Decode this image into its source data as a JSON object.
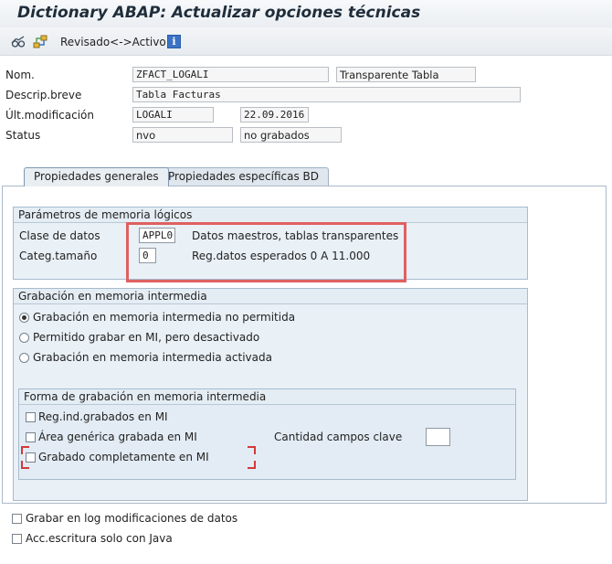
{
  "title": "Dictionary ABAP: Actualizar opciones técnicas",
  "toolbar": {
    "toggle_label": "Revisado<->Activo",
    "icons": [
      "glasses-icon",
      "hierarchy-icon",
      "info-icon"
    ]
  },
  "header": {
    "name_label": "Nom.",
    "name_value": "ZFACT_LOGALI",
    "table_type": "Transparente Tabla",
    "desc_label": "Descrip.breve",
    "desc_value": "Tabla Facturas",
    "lastmod_label": "Últ.modificación",
    "lastmod_user": "LOGALI",
    "lastmod_date": "22.09.2016",
    "status_label": "Status",
    "status_value": "nvo",
    "status_text": "no grabados"
  },
  "tabs": [
    {
      "label": "Propiedades generales",
      "active": true
    },
    {
      "label": "Propiedades específicas BD",
      "active": false
    }
  ],
  "memory_params": {
    "title": "Parámetros de memoria lógicos",
    "data_class_label": "Clase de datos",
    "data_class_value": "APPL0",
    "data_class_desc": "Datos maestros, tablas transparentes",
    "size_label": "Categ.tamaño",
    "size_value": "0",
    "size_desc": "Reg.datos esperados 0 A 11.000"
  },
  "buffering": {
    "title": "Grabación en memoria intermedia",
    "options": [
      {
        "label": "Grabación en memoria intermedia no permitida",
        "selected": true
      },
      {
        "label": "Permitido grabar en MI, pero desactivado",
        "selected": false
      },
      {
        "label": "Grabación en memoria intermedia activada",
        "selected": false
      }
    ],
    "type_group": {
      "title": "Forma de grabación en memoria intermedia",
      "single_records": "Reg.ind.grabados en MI",
      "generic_area": "Área genérica grabada en MI",
      "key_fields_label": "Cantidad campos clave",
      "key_fields_value": "",
      "fully_buffered": "Grabado completamente en MI"
    }
  },
  "log_changes": "Grabar en log modificaciones de datos",
  "java_only": "Acc.escritura solo con Java",
  "colors": {
    "highlight": "#e06060",
    "group_bg": "#e9f0f6",
    "group_border": "#a7bccf"
  }
}
